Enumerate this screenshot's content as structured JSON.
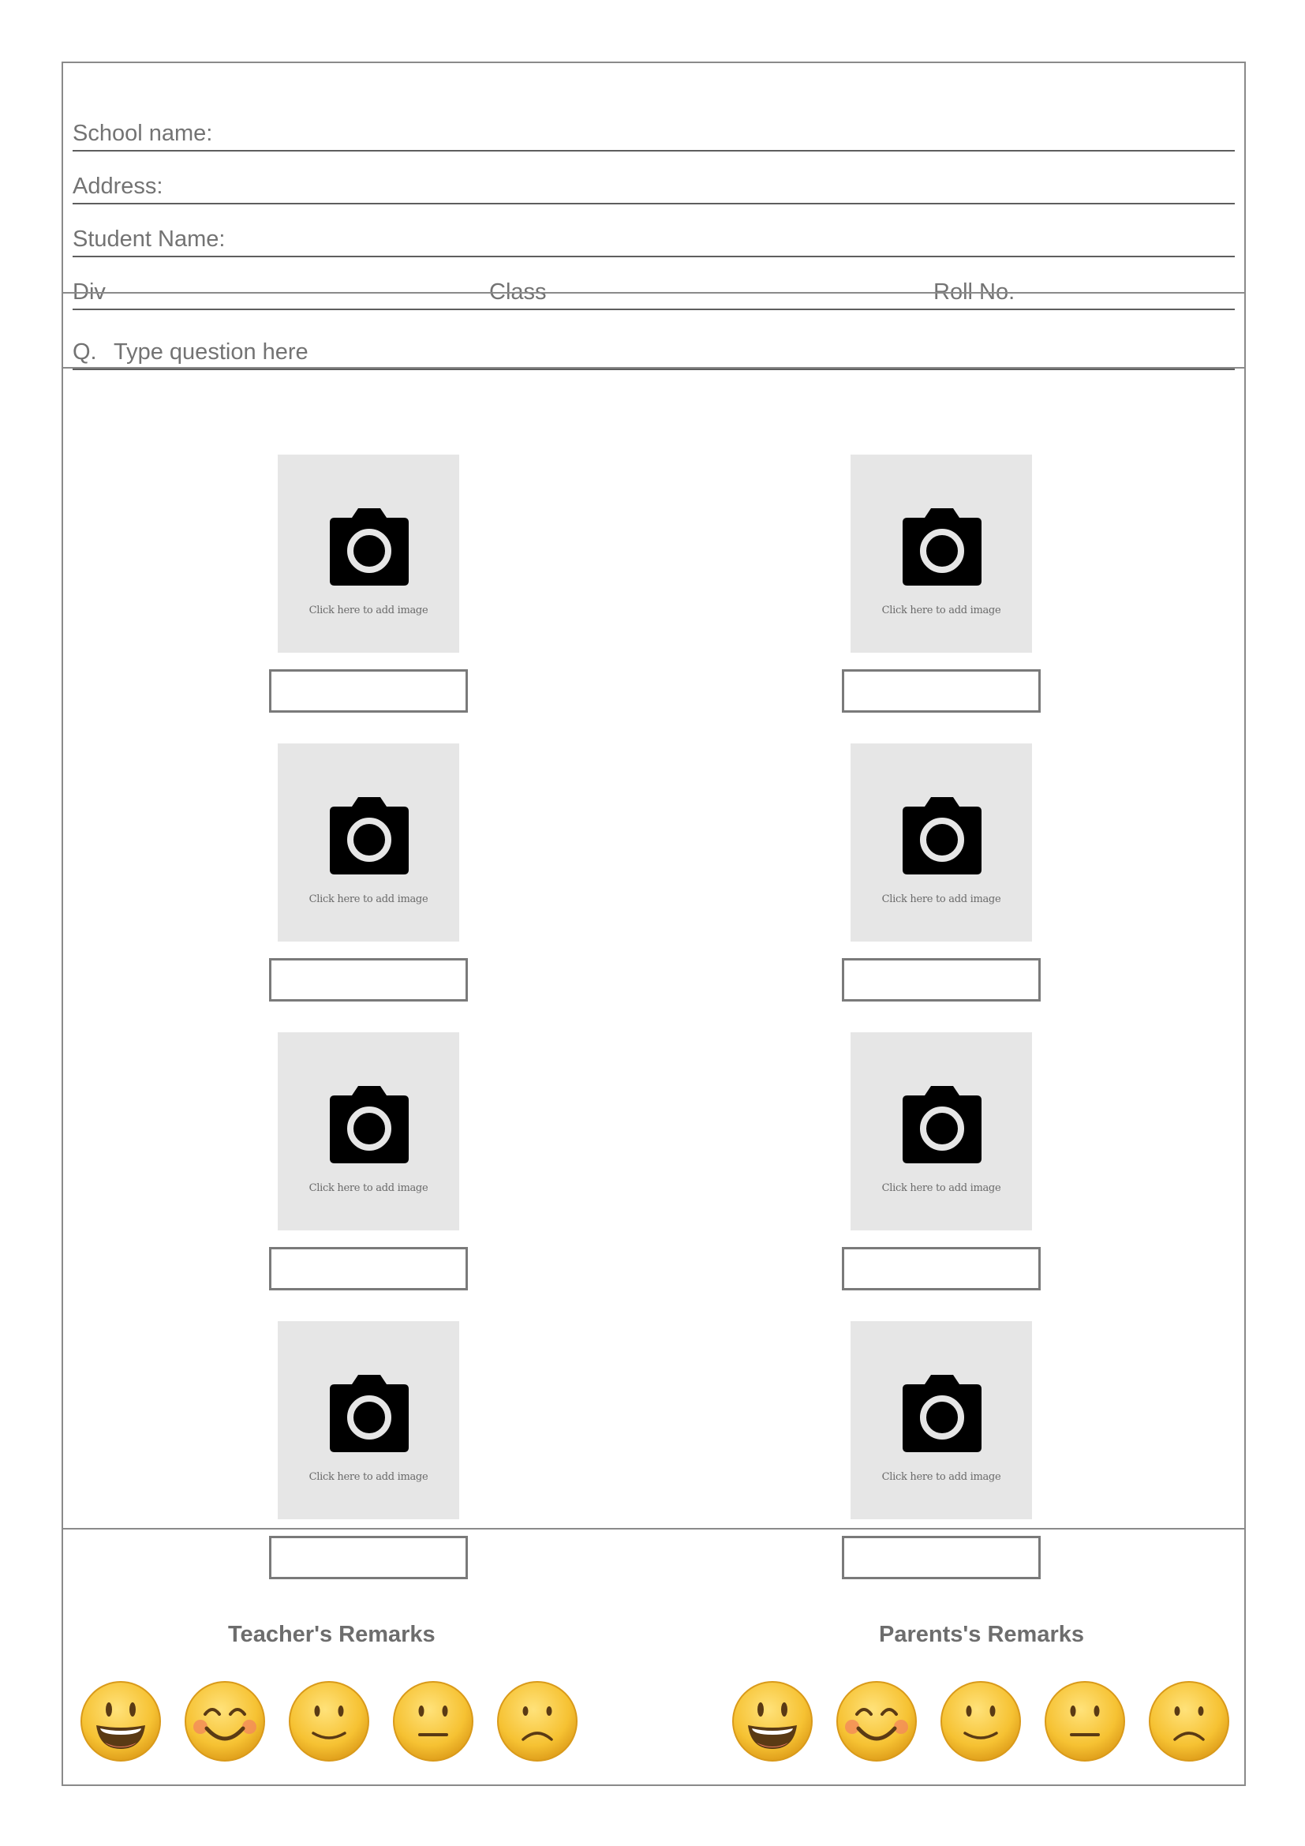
{
  "header": {
    "school_name_label": "School name:",
    "address_label": "Address:",
    "student_name_label": "Student Name:",
    "div_label": "Div",
    "class_label": "Class",
    "roll_label": "Roll No."
  },
  "question": {
    "prefix": "Q.",
    "placeholder": "Type question here"
  },
  "photo_slots": {
    "caption": "Click here to add image",
    "count": 8
  },
  "remarks": {
    "teacher_title": "Teacher's Remarks",
    "parents_title": "Parents's Remarks",
    "emoji_scale": [
      "grinning",
      "blushing-smile",
      "smile",
      "neutral",
      "frown"
    ]
  },
  "colors": {
    "border": "#8a8a8a",
    "rule": "#5e5e5e",
    "placeholder_bg": "#e6e6e6",
    "emoji_yellow": "#f6c233"
  }
}
